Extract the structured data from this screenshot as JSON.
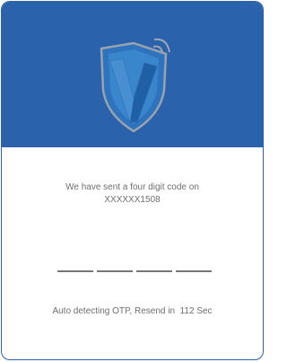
{
  "header": {
    "logo_icon": "v-shield-logo-icon",
    "background_color": "#2b62ac"
  },
  "message": {
    "line1": "We have sent a four digit code on",
    "line2": "XXXXXX1508"
  },
  "otp": {
    "slots": [
      "",
      "",
      "",
      ""
    ]
  },
  "status": {
    "prefix": "Auto detecting OTP, Resend in",
    "seconds": "112",
    "unit": "Sec"
  }
}
